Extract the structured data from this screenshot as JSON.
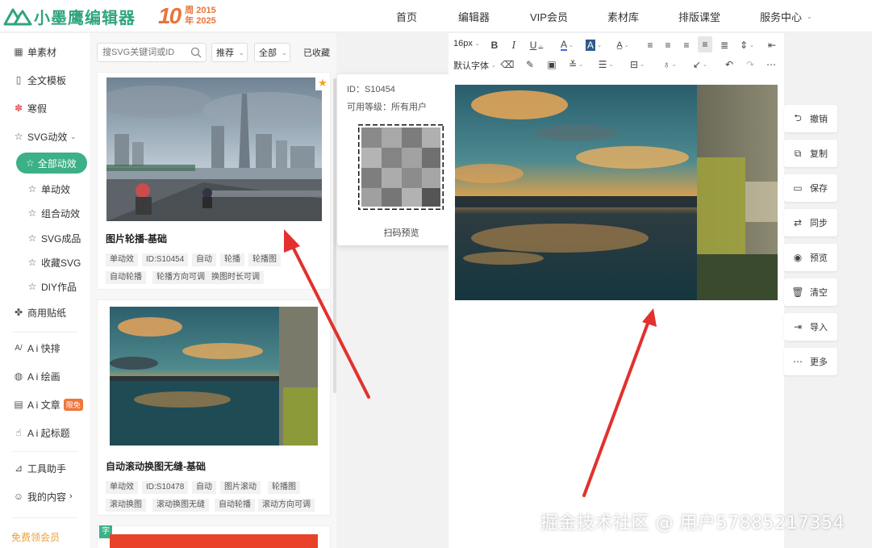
{
  "header": {
    "logo_text": "小墨鹰编辑器",
    "anniv_number": "10",
    "anniv_years_top": "周 2015",
    "anniv_years_bottom": "年 2025",
    "nav": [
      "首页",
      "编辑器",
      "VIP会员",
      "素材库",
      "排版课堂",
      "服务中心"
    ]
  },
  "sidebar": {
    "items": [
      {
        "label": "单素材",
        "icon": "grid-icon"
      },
      {
        "label": "全文模板",
        "icon": "template-icon"
      },
      {
        "label": "寒假",
        "icon": "snow-icon"
      },
      {
        "label": "SVG动效",
        "icon": "star-icon"
      },
      {
        "label": "全部动效",
        "icon": "star-icon"
      },
      {
        "label": "单动效",
        "icon": "star-icon"
      },
      {
        "label": "组合动效",
        "icon": "star-icon"
      },
      {
        "label": "SVG成品",
        "icon": "star-icon"
      },
      {
        "label": "收藏SVG",
        "icon": "star-icon"
      },
      {
        "label": "DIY作品",
        "icon": "star-icon"
      },
      {
        "label": "商用贴纸",
        "icon": "puzzle-icon"
      },
      {
        "label": "A i 快排",
        "icon": "ai-icon"
      },
      {
        "label": "A i 绘画",
        "icon": "palette-icon"
      },
      {
        "label": "A i 文章",
        "icon": "doc-icon",
        "badge": "限免"
      },
      {
        "label": "A i 起标题",
        "icon": "hand-icon"
      },
      {
        "label": "工具助手",
        "icon": "tool-icon"
      },
      {
        "label": "我的内容",
        "icon": "user-icon"
      },
      {
        "label": "免费领会员",
        "icon": ""
      }
    ]
  },
  "panel": {
    "search_placeholder": "搜SVG关键词或ID",
    "sort_label": "推荐",
    "filter_label": "全部",
    "fav_label": "已收藏",
    "cards": [
      {
        "title": "图片轮播-基础",
        "tags": [
          "单动效",
          "ID:S10454",
          "自动",
          "轮播",
          "轮播图",
          "自动轮播",
          "轮播方向可调",
          "换图时长可调"
        ]
      },
      {
        "title": "自动滚动换图无缝-基础",
        "tags": [
          "单动效",
          "ID:S10478",
          "自动",
          "图片滚动",
          "轮播图",
          "滚动换图",
          "滚动换图无缝",
          "自动轮播",
          "滚动方向可调"
        ]
      }
    ],
    "third_card_badge": "字"
  },
  "popup": {
    "id_line": "ID：S10454",
    "level_line": "可用等级：所有用户",
    "scan_label": "扫码预览"
  },
  "toolbar": {
    "font_size": "16px",
    "font_family": "默认字体"
  },
  "actions": [
    "撤销",
    "复制",
    "保存",
    "同步",
    "预览",
    "清空",
    "导入",
    "更多"
  ],
  "watermark": "掘金技术社区 @ 用户57885217354",
  "colors": {
    "brand": "#3cb087",
    "orange": "#e8743b",
    "arrow": "#e2312e"
  }
}
